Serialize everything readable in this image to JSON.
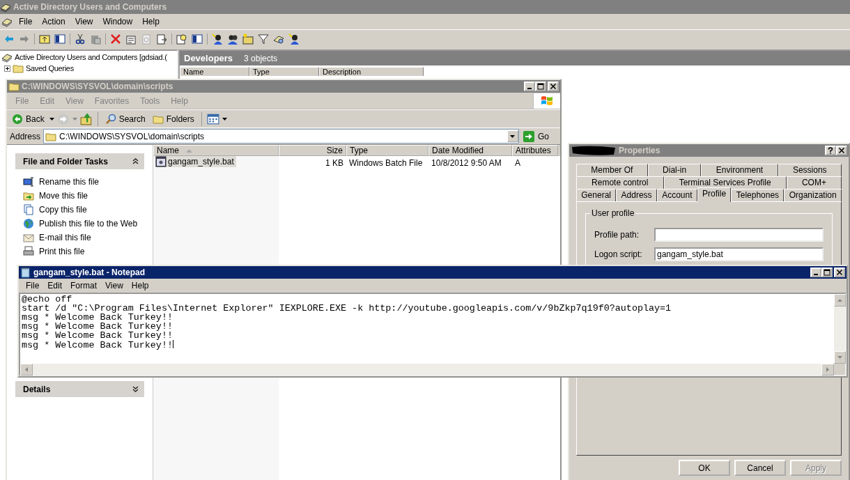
{
  "mmc": {
    "title": "Active Directory Users and Computers",
    "active": false,
    "menu": [
      "File",
      "Action",
      "View",
      "Window",
      "Help"
    ],
    "tree": [
      {
        "label": "Active Directory Users and Computers [gdsiad.(",
        "children": [
          {
            "label": "Saved Queries"
          }
        ]
      }
    ],
    "panel": {
      "title": "Developers",
      "count": "3 objects",
      "columns": [
        "Name",
        "Type",
        "Description"
      ]
    }
  },
  "explorer": {
    "title": "C:\\WINDOWS\\SYSVOL\\domain\\scripts",
    "active": false,
    "menu": [
      "File",
      "Edit",
      "View",
      "Favorites",
      "Tools",
      "Help"
    ],
    "toolbar": {
      "back": "Back",
      "search": "Search",
      "folders": "Folders"
    },
    "address_label": "Address",
    "address": "C:\\WINDOWS\\SYSVOL\\domain\\scripts",
    "go": "Go",
    "tasks": {
      "title": "File and Folder Tasks",
      "items": [
        "Rename this file",
        "Move this file",
        "Copy this file",
        "Publish this file to the Web",
        "E-mail this file",
        "Print this file"
      ]
    },
    "details": {
      "title": "Details"
    },
    "columns": [
      "Name",
      "Size",
      "Type",
      "Date Modified",
      "Attributes"
    ],
    "files": [
      {
        "name": "gangam_style.bat",
        "size": "1 KB",
        "type": "Windows Batch File",
        "modified": "10/8/2012 9:50 AM",
        "attributes": "A",
        "selected": true
      }
    ]
  },
  "properties": {
    "title": "Properties",
    "active": false,
    "tab_rows": [
      [
        {
          "label": "Member Of",
          "selected": false
        },
        {
          "label": "Dial-in",
          "selected": false
        },
        {
          "label": "Environment",
          "selected": false
        },
        {
          "label": "Sessions",
          "selected": false
        }
      ],
      [
        {
          "label": "Remote control",
          "selected": false
        },
        {
          "label": "Terminal Services Profile",
          "selected": false
        },
        {
          "label": "COM+",
          "selected": false
        }
      ],
      [
        {
          "label": "General",
          "selected": false
        },
        {
          "label": "Address",
          "selected": false
        },
        {
          "label": "Account",
          "selected": false
        },
        {
          "label": "Profile",
          "selected": true
        },
        {
          "label": "Telephones",
          "selected": false
        },
        {
          "label": "Organization",
          "selected": false
        }
      ]
    ],
    "group": "User profile",
    "fields": [
      {
        "label": "Profile path:"
      },
      {
        "label": "Logon script:",
        "value": "gangam_style.bat"
      }
    ],
    "buttons": [
      {
        "label": "OK",
        "disabled": false
      },
      {
        "label": "Cancel",
        "disabled": false
      },
      {
        "label": "Apply",
        "disabled": true
      }
    ]
  },
  "notepad": {
    "title": "gangam_style.bat - Notepad",
    "active": true,
    "menu": [
      "File",
      "Edit",
      "Format",
      "View",
      "Help"
    ],
    "lines": [
      "@echo off",
      "start /d \"C:\\Program Files\\Internet Explorer\" IEXPLORE.EXE -k http://youtube.googleapis.com/v/9bZkp7q19f0?autoplay=1",
      "msg * Welcome Back Turkey!!",
      "msg * Welcome Back Turkey!!",
      "msg * Welcome Back Turkey!!",
      "msg * Welcome Back Turkey!!"
    ]
  }
}
